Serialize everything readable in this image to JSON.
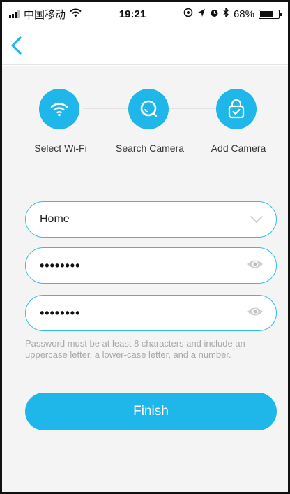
{
  "status_bar": {
    "carrier": "中国移动",
    "time": "19:21",
    "battery": "68%",
    "icons": [
      "signal-icon",
      "wifi-icon",
      "location-lock-icon",
      "navigation-icon",
      "alarm-icon",
      "bluetooth-icon",
      "battery-icon"
    ]
  },
  "nav": {
    "back_icon": "chevron-left-icon"
  },
  "steps": [
    {
      "label": "Select Wi-Fi",
      "icon": "wifi-icon"
    },
    {
      "label": "Search Camera",
      "icon": "search-icon"
    },
    {
      "label": "Add Camera",
      "icon": "camera-lock-icon"
    }
  ],
  "form": {
    "network": {
      "value": "Home",
      "icon": "chevron-down-icon"
    },
    "password": {
      "value": "••••••••",
      "icon": "eye-icon"
    },
    "confirm_password": {
      "value": "••••••••",
      "icon": "eye-icon"
    },
    "hint": "Password must be at least 8 characters and include an uppercase letter, a lower-case letter, and a number.",
    "finish_label": "Finish"
  },
  "colors": {
    "accent": "#1fb6ea",
    "field_border": "#30bde8",
    "hint": "#a8a8a8",
    "background": "#f4f4f4"
  }
}
